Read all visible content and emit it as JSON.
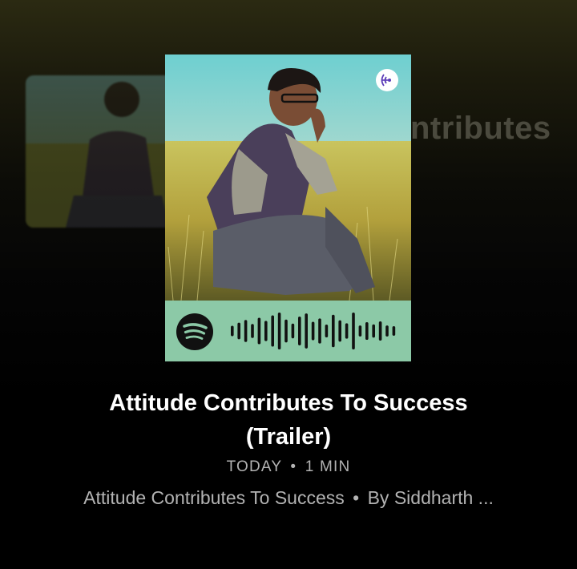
{
  "background_title": "ntributes",
  "card": {
    "cover_icon": "podcast-person-in-field-image",
    "badge_icon": "podcast-broadcast-icon",
    "code_logo_icon": "spotify-logo-icon",
    "code_bars": [
      0.28,
      0.45,
      0.6,
      0.38,
      0.72,
      0.55,
      0.85,
      1.0,
      0.62,
      0.4,
      0.78,
      0.95,
      0.5,
      0.68,
      0.35,
      0.88,
      0.58,
      0.42,
      1.0,
      0.3,
      0.48,
      0.36,
      0.52,
      0.3,
      0.26
    ],
    "code_color": "#8cc9a7"
  },
  "episode": {
    "title_line1": "Attitude Contributes To Success",
    "title_line2": "(Trailer)",
    "date": "TODAY",
    "separator": "•",
    "duration": "1 MIN",
    "show_name": "Attitude Contributes To Success",
    "author": "By Siddharth ..."
  },
  "colors": {
    "background_top": "#2b2a12",
    "text_primary": "#ffffff",
    "text_secondary": "#b3b3b3"
  }
}
